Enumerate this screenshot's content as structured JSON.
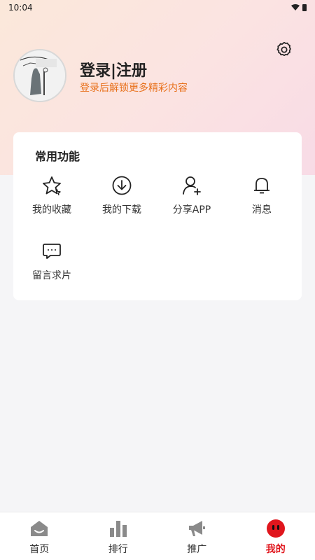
{
  "status_bar": {
    "time": "10:04"
  },
  "profile": {
    "title": "登录|注册",
    "subtitle": "登录后解锁更多精彩内容",
    "avatar_icon": "avatar-image"
  },
  "settings": {
    "icon": "gear-icon"
  },
  "features": {
    "title": "常用功能",
    "items": [
      {
        "label": "我的收藏",
        "icon": "star-icon"
      },
      {
        "label": "我的下载",
        "icon": "download-icon"
      },
      {
        "label": "分享APP",
        "icon": "add-user-icon"
      },
      {
        "label": "消息",
        "icon": "bell-icon"
      },
      {
        "label": "留言求片",
        "icon": "chat-icon"
      }
    ]
  },
  "tabbar": {
    "items": [
      {
        "label": "首页",
        "icon": "home-icon",
        "active": false
      },
      {
        "label": "排行",
        "icon": "chart-icon",
        "active": false
      },
      {
        "label": "推广",
        "icon": "megaphone-icon",
        "active": false
      },
      {
        "label": "我的",
        "icon": "face-icon",
        "active": true
      }
    ]
  },
  "colors": {
    "accent": "#e0161d",
    "subtitle": "#e8701a"
  }
}
